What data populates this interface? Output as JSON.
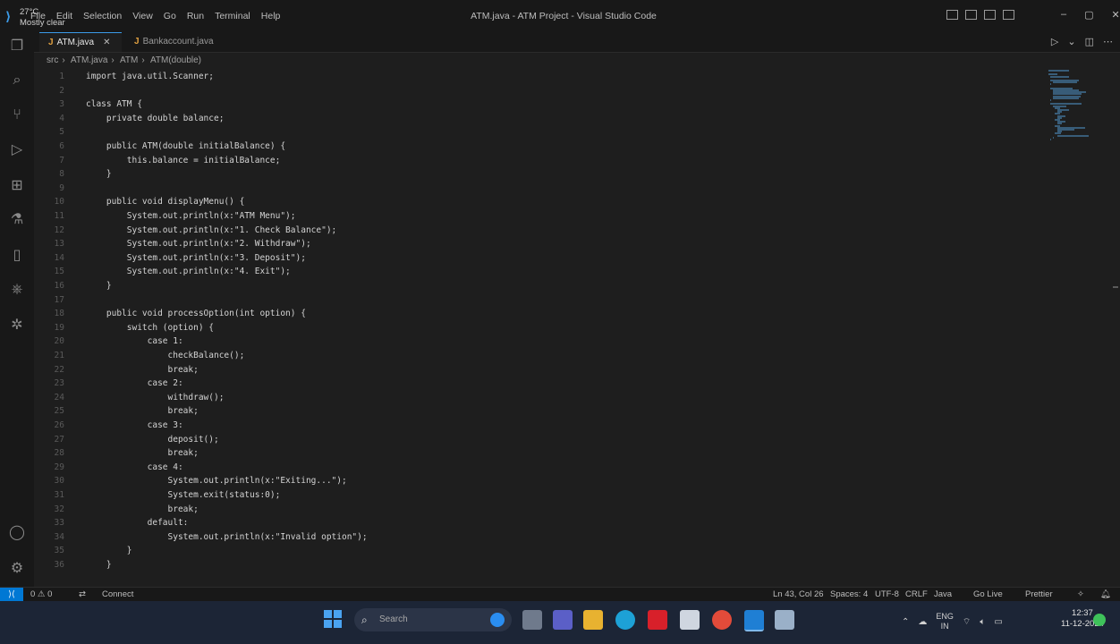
{
  "titlebar": {
    "window_title": "ATM.java - ATM Project - Visual Studio Code",
    "menu": [
      "File",
      "Edit",
      "Selection",
      "View",
      "Go",
      "Run",
      "Terminal",
      "Help"
    ]
  },
  "tabs": [
    {
      "label": "ATM.java",
      "active": true
    },
    {
      "label": "Bankaccount.java",
      "active": false
    }
  ],
  "breadcrumb": [
    "src",
    "ATM.java",
    "ATM",
    "ATM(double)"
  ],
  "code_lines": [
    {
      "n": "1",
      "text": "import java.util.Scanner;"
    },
    {
      "n": "2",
      "text": ""
    },
    {
      "n": "3",
      "text": "class ATM {"
    },
    {
      "n": "4",
      "text": "    private double balance;"
    },
    {
      "n": "5",
      "text": ""
    },
    {
      "n": "6",
      "text": "    public ATM(double initialBalance) {"
    },
    {
      "n": "7",
      "text": "        this.balance = initialBalance;"
    },
    {
      "n": "8",
      "text": "    }"
    },
    {
      "n": "9",
      "text": ""
    },
    {
      "n": "10",
      "text": "    public void displayMenu() {"
    },
    {
      "n": "11",
      "text": "        System.out.println(x:\"ATM Menu\");"
    },
    {
      "n": "12",
      "text": "        System.out.println(x:\"1. Check Balance\");"
    },
    {
      "n": "13",
      "text": "        System.out.println(x:\"2. Withdraw\");"
    },
    {
      "n": "14",
      "text": "        System.out.println(x:\"3. Deposit\");"
    },
    {
      "n": "15",
      "text": "        System.out.println(x:\"4. Exit\");"
    },
    {
      "n": "16",
      "text": "    }"
    },
    {
      "n": "17",
      "text": ""
    },
    {
      "n": "18",
      "text": "    public void processOption(int option) {"
    },
    {
      "n": "19",
      "text": "        switch (option) {"
    },
    {
      "n": "20",
      "text": "            case 1:"
    },
    {
      "n": "21",
      "text": "                checkBalance();"
    },
    {
      "n": "22",
      "text": "                break;"
    },
    {
      "n": "23",
      "text": "            case 2:"
    },
    {
      "n": "24",
      "text": "                withdraw();"
    },
    {
      "n": "25",
      "text": "                break;"
    },
    {
      "n": "26",
      "text": "            case 3:"
    },
    {
      "n": "27",
      "text": "                deposit();"
    },
    {
      "n": "28",
      "text": "                break;"
    },
    {
      "n": "29",
      "text": "            case 4:"
    },
    {
      "n": "30",
      "text": "                System.out.println(x:\"Exiting...\");"
    },
    {
      "n": "31",
      "text": "                System.exit(status:0);"
    },
    {
      "n": "32",
      "text": "                break;"
    },
    {
      "n": "33",
      "text": "            default:"
    },
    {
      "n": "34",
      "text": "                System.out.println(x:\"Invalid option\");"
    },
    {
      "n": "35",
      "text": "        }"
    },
    {
      "n": "36",
      "text": "    }"
    }
  ],
  "statusbar": {
    "problems": "0 ⚠ 0",
    "connect": "Connect",
    "position": "Ln 43, Col 26",
    "spaces": "Spaces: 4",
    "encoding": "UTF-8",
    "eol": "CRLF",
    "language": "Java",
    "golive": "Go Live",
    "prettier": "Prettier"
  },
  "taskbar": {
    "weather_temp": "27°C",
    "weather_desc": "Mostly clear",
    "search_placeholder": "Search",
    "lang": "ENG",
    "region": "IN",
    "time": "12:37",
    "date": "11-12-2024"
  },
  "colors": {
    "accent": "#0078d4",
    "tab_active_border": "#3c9be8"
  }
}
